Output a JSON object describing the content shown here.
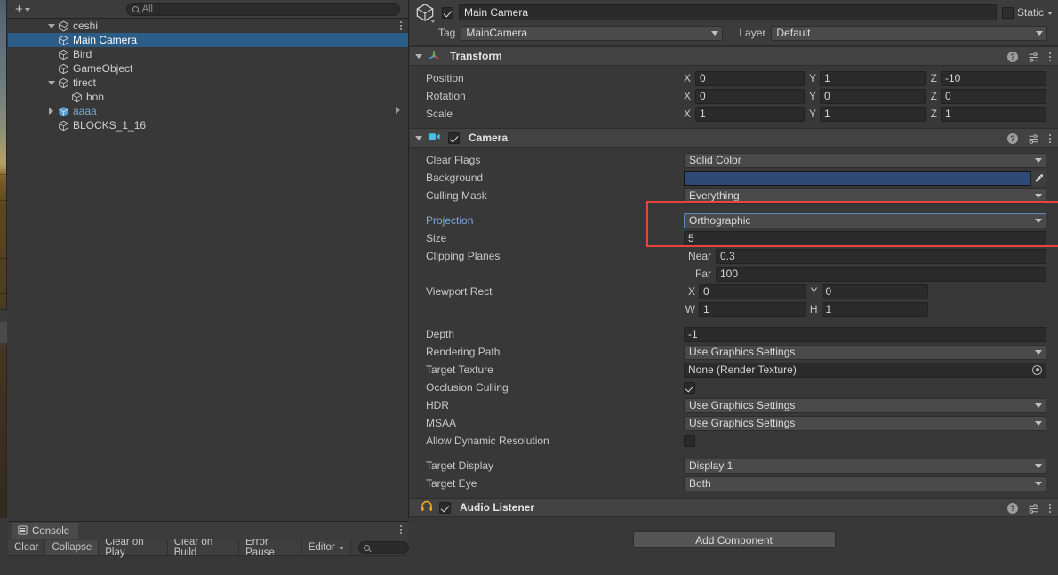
{
  "hierarchy": {
    "toolbar": {
      "add_label": "+",
      "search_placeholder": "All",
      "search_value": "",
      "search_icon": "search-icon"
    },
    "rows": [
      {
        "label": "ceshi",
        "icon": "unity-scene-icon",
        "indent": 0,
        "twisty": "down",
        "selected": false,
        "kind": "scene",
        "kebab": true
      },
      {
        "label": "Main Camera",
        "icon": "gameobject-cube-icon",
        "indent": 1,
        "twisty": "none",
        "selected": true,
        "kind": "gameobject"
      },
      {
        "label": "Bird",
        "icon": "gameobject-cube-icon",
        "indent": 1,
        "twisty": "none",
        "selected": false,
        "kind": "gameobject"
      },
      {
        "label": "GameObject",
        "icon": "gameobject-cube-icon",
        "indent": 1,
        "twisty": "none",
        "selected": false,
        "kind": "gameobject"
      },
      {
        "label": "tirect",
        "icon": "gameobject-cube-icon",
        "indent": 1,
        "twisty": "down",
        "selected": false,
        "kind": "gameobject"
      },
      {
        "label": "bon",
        "icon": "gameobject-cube-icon",
        "indent": 2,
        "twisty": "none",
        "selected": false,
        "kind": "gameobject"
      },
      {
        "label": "aaaa",
        "icon": "prefab-cube-icon",
        "indent": 1,
        "twisty": "right",
        "selected": false,
        "kind": "prefab",
        "chevron": true
      },
      {
        "label": "BLOCKS_1_16",
        "icon": "gameobject-cube-icon",
        "indent": 1,
        "twisty": "none",
        "selected": false,
        "kind": "gameobject"
      }
    ]
  },
  "console": {
    "tab_label": "Console",
    "tab_icon": "console-list-icon",
    "buttons": [
      {
        "label": "Clear",
        "active": false
      },
      {
        "label": "Collapse",
        "active": true
      },
      {
        "label": "Clear on Play",
        "active": false
      },
      {
        "label": "Clear on Build",
        "active": false
      },
      {
        "label": "Error Pause",
        "active": false
      }
    ],
    "editor_dropdown": "Editor",
    "search_value": "",
    "search_icon": "search-icon"
  },
  "inspector": {
    "object": {
      "icon": "gameobject-cube-icon",
      "enabled": true,
      "name": "Main Camera",
      "static_label": "Static",
      "static_checked": false,
      "tag_label": "Tag",
      "tag_value": "MainCamera",
      "layer_label": "Layer",
      "layer_value": "Default"
    },
    "components": [
      {
        "title": "Transform",
        "icon": "transform-axis-icon",
        "has_enable_checkbox": false,
        "expanded": true,
        "tools": [
          "help-icon",
          "preset-icon",
          "kebab-menu-icon"
        ],
        "rows": [
          {
            "type": "vector3",
            "label": "Position",
            "x": "0",
            "y": "1",
            "z": "-10"
          },
          {
            "type": "vector3",
            "label": "Rotation",
            "x": "0",
            "y": "0",
            "z": "0"
          },
          {
            "type": "vector3",
            "label": "Scale",
            "x": "1",
            "y": "1",
            "z": "1"
          }
        ]
      },
      {
        "title": "Camera",
        "icon": "camera-icon",
        "has_enable_checkbox": true,
        "enabled": true,
        "expanded": true,
        "tools": [
          "help-icon",
          "preset-icon",
          "kebab-menu-icon"
        ],
        "rows": [
          {
            "type": "dropdown",
            "label": "Clear Flags",
            "value": "Solid Color"
          },
          {
            "type": "color",
            "label": "Background",
            "color": "#2f4a74",
            "eyedropper": true
          },
          {
            "type": "dropdown",
            "label": "Culling Mask",
            "value": "Everything"
          },
          {
            "type": "spacer"
          },
          {
            "type": "dropdown",
            "label": "Projection",
            "value": "Orthographic",
            "accent": true,
            "focused": true
          },
          {
            "type": "text",
            "label": "Size",
            "value": "5"
          },
          {
            "type": "pair",
            "label": "Clipping Planes",
            "sub_label": "Near",
            "value": "0.3"
          },
          {
            "type": "pair",
            "label": "",
            "sub_label": "Far",
            "value": "100"
          },
          {
            "type": "xy",
            "label": "Viewport Rect",
            "a_label": "X",
            "a": "0",
            "b_label": "Y",
            "b": "0"
          },
          {
            "type": "xy",
            "label": "",
            "a_label": "W",
            "a": "1",
            "b_label": "H",
            "b": "1"
          },
          {
            "type": "spacer"
          },
          {
            "type": "text",
            "label": "Depth",
            "value": "-1"
          },
          {
            "type": "dropdown",
            "label": "Rendering Path",
            "value": "Use Graphics Settings"
          },
          {
            "type": "object",
            "label": "Target Texture",
            "value": "None (Render Texture)"
          },
          {
            "type": "checkbox",
            "label": "Occlusion Culling",
            "checked": true
          },
          {
            "type": "dropdown",
            "label": "HDR",
            "value": "Use Graphics Settings"
          },
          {
            "type": "dropdown",
            "label": "MSAA",
            "value": "Use Graphics Settings"
          },
          {
            "type": "checkbox",
            "label": "Allow Dynamic Resolution",
            "checked": false
          },
          {
            "type": "spacer"
          },
          {
            "type": "dropdown",
            "label": "Target Display",
            "value": "Display 1"
          },
          {
            "type": "dropdown",
            "label": "Target Eye",
            "value": "Both"
          }
        ]
      },
      {
        "title": "Audio Listener",
        "icon": "audio-listener-icon",
        "has_enable_checkbox": true,
        "enabled": true,
        "expanded": false,
        "tools": [
          "help-icon",
          "preset-icon",
          "kebab-menu-icon"
        ],
        "rows": []
      }
    ],
    "add_component_label": "Add Component"
  },
  "annotation": {
    "highlight_color": "#e8453c",
    "highlight_target": "projection-and-size-fields"
  }
}
